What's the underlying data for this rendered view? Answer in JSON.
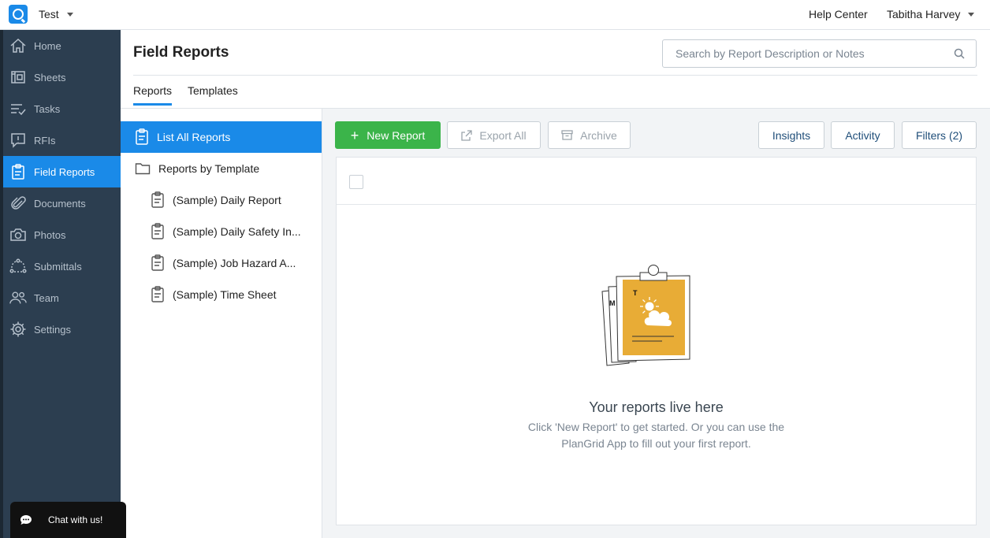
{
  "topbar": {
    "project_name": "Test",
    "help_center": "Help Center",
    "user_name": "Tabitha Harvey"
  },
  "nav": [
    {
      "label": "Home",
      "icon": "home-icon"
    },
    {
      "label": "Sheets",
      "icon": "sheets-icon"
    },
    {
      "label": "Tasks",
      "icon": "tasks-icon"
    },
    {
      "label": "RFIs",
      "icon": "rfi-icon"
    },
    {
      "label": "Field Reports",
      "icon": "clipboard-icon",
      "active": true
    },
    {
      "label": "Documents",
      "icon": "paperclip-icon"
    },
    {
      "label": "Photos",
      "icon": "camera-icon"
    },
    {
      "label": "Submittals",
      "icon": "submittals-icon"
    },
    {
      "label": "Team",
      "icon": "team-icon"
    },
    {
      "label": "Settings",
      "icon": "gear-icon"
    }
  ],
  "header": {
    "title": "Field Reports",
    "search_placeholder": "Search by Report Description or Notes",
    "tabs": [
      "Reports",
      "Templates"
    ]
  },
  "subnav": {
    "list_all": "List All Reports",
    "by_template": "Reports by Template",
    "templates": [
      "(Sample) Daily Report",
      "(Sample) Daily Safety In...",
      "(Sample) Job Hazard A...",
      "(Sample) Time Sheet"
    ]
  },
  "toolbar": {
    "new_report": "New Report",
    "export_all": "Export All",
    "archive": "Archive",
    "insights": "Insights",
    "activity": "Activity",
    "filters": "Filters (2)"
  },
  "empty_state": {
    "illustration_letters": [
      "M",
      "T"
    ],
    "title": "Your reports live here",
    "description": "Click 'New Report' to get started. Or you can use the PlanGrid App to fill out your first report."
  },
  "chat": {
    "label": "Chat with us!"
  },
  "colors": {
    "accent": "#1a8ae8",
    "nav_bg": "#2c3e50",
    "primary_button": "#3bb44a",
    "illustration": "#e8ac36"
  }
}
